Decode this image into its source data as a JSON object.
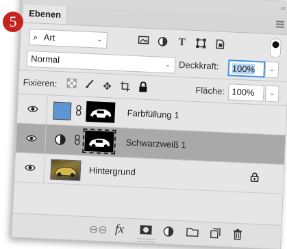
{
  "badge": "5",
  "panel": {
    "collapse_glyph": "‹‹",
    "tab_label": "Ebenen",
    "menu_icon": "panel-menu-icon"
  },
  "filter": {
    "kind_value": "Art",
    "search_glyph": "⌕",
    "icons": [
      "pixel-filter-icon",
      "adjustment-filter-icon",
      "type-filter-icon",
      "shape-filter-icon",
      "smartobject-filter-icon"
    ],
    "type_glyph": "T"
  },
  "blend": {
    "mode_value": "Normal",
    "opacity_label": "Deckkraft:",
    "opacity_value": "100%"
  },
  "lock": {
    "label": "Fixieren:",
    "fill_label": "Fläche:",
    "fill_value": "100%"
  },
  "layers": [
    {
      "name": "Farbfüllung 1",
      "type": "color-fill",
      "swatch_color": "#5d97d1"
    },
    {
      "name": "Schwarzweiß 1",
      "type": "adjustment",
      "selected": true
    },
    {
      "name": "Hintergrund",
      "type": "background",
      "locked": true
    }
  ],
  "footer": {
    "fx_label": "fx"
  },
  "colors": {
    "badge": "#c6241f",
    "selection": "#a9a9a9",
    "focus_ring": "#3d8ee3"
  }
}
